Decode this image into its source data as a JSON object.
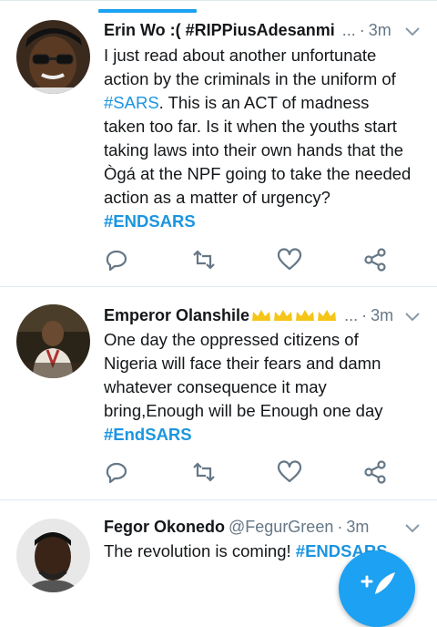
{
  "tweets": [
    {
      "name": "Erin Wo :( #RIPPiusAdesanmi",
      "handle": "",
      "ellipsis": "...",
      "dot": "·",
      "time": "3m",
      "lines": [
        [
          "I just read about another unfortunate"
        ],
        [
          "action by the criminals in  the uniform of"
        ],
        [
          "#SARS",
          ". This is an ACT of madness"
        ],
        [
          "taken too far. Is it when the youths start"
        ],
        [
          "taking laws into their own hands that the"
        ],
        [
          "Ògá at the NPF going to take the needed"
        ],
        [
          "action as a matter of urgency?"
        ],
        [
          "#ENDSARS"
        ]
      ]
    },
    {
      "name": "Emperor Olanshile",
      "ellipsis": "...",
      "dot": "·",
      "time": "3m",
      "lines": [
        [
          "One day the oppressed citizens of"
        ],
        [
          "Nigeria will face their fears and damn"
        ],
        [
          "whatever consequence it may"
        ],
        [
          "bring,Enough will be Enough one day"
        ],
        [
          "#EndSARS"
        ]
      ]
    },
    {
      "name": "Fegor Okonedo",
      "handle": "@FegurGreen",
      "dot": "·",
      "time": "3m",
      "text": "The revolution is coming! ",
      "tag": "#ENDSARS"
    }
  ],
  "icons": {
    "reply": "reply-icon",
    "retweet": "retweet-icon",
    "like": "heart-icon",
    "share": "share-icon",
    "menu": "chevron-down-icon",
    "compose": "compose-tweet-icon"
  },
  "colors": {
    "accent": "#1da1f2",
    "link": "#1b95e0",
    "secondary": "#657786",
    "divider": "#e1e8ed",
    "crown": "#f5c518"
  }
}
